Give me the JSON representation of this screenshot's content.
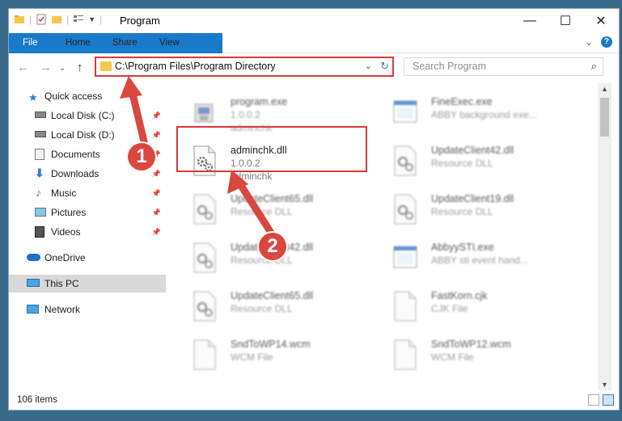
{
  "titlebar": {
    "title": "Program",
    "minimize": "—",
    "maximize": "☐",
    "close": "✕"
  },
  "ribbon": {
    "tabs": [
      "File",
      "Home",
      "Share",
      "View"
    ],
    "expand": "⌄",
    "help": "?"
  },
  "address": {
    "path": "C:\\Program Files\\Program Directory",
    "dropdown": "⌄",
    "refresh": "↻"
  },
  "search": {
    "placeholder": "Search Program",
    "icon": "⌕"
  },
  "nav": {
    "back": "←",
    "forward": "→",
    "history": "⌄",
    "up": "↑"
  },
  "sidebar": {
    "items": [
      {
        "label": "Quick access",
        "icon": "star-icon",
        "pinned": false
      },
      {
        "label": "Local Disk (C:)",
        "icon": "drive-icon",
        "pinned": true
      },
      {
        "label": "Local Disk (D:)",
        "icon": "drive-icon",
        "pinned": true
      },
      {
        "label": "Documents",
        "icon": "documents-icon",
        "pinned": true
      },
      {
        "label": "Downloads",
        "icon": "downloads-icon",
        "pinned": true
      },
      {
        "label": "Music",
        "icon": "music-icon",
        "pinned": true
      },
      {
        "label": "Pictures",
        "icon": "pictures-icon",
        "pinned": true
      },
      {
        "label": "Videos",
        "icon": "videos-icon",
        "pinned": true
      },
      {
        "label": "OneDrive",
        "icon": "cloud-icon",
        "pinned": false
      },
      {
        "label": "This PC",
        "icon": "computer-icon",
        "pinned": false
      },
      {
        "label": "Network",
        "icon": "network-icon",
        "pinned": false
      }
    ],
    "pin_glyph": "📌"
  },
  "files": [
    {
      "name": "program.exe",
      "line2": "1.0.0.2",
      "line3": "adminchk",
      "icon": "exe-icon",
      "blurred": true
    },
    {
      "name": "FineExec.exe",
      "line2": "ABBY background exe...",
      "line3": "",
      "icon": "app-window-icon",
      "blurred": true
    },
    {
      "name": "adminchk.dll",
      "line2": "1.0.0.2",
      "line3": "adminchk",
      "icon": "dll-gear-icon",
      "blurred": false
    },
    {
      "name": "UpdateClient42.dll",
      "line2": "Resource DLL",
      "line3": "",
      "icon": "dll-gear-icon",
      "blurred": true
    },
    {
      "name": "UpdateClient65.dll",
      "line2": "Resource DLL",
      "line3": "",
      "icon": "dll-gear-icon",
      "blurred": true
    },
    {
      "name": "UpdateClient19.dll",
      "line2": "Resource DLL",
      "line3": "",
      "icon": "dll-gear-icon",
      "blurred": true
    },
    {
      "name": "UpdateClient42.dll",
      "line2": "Resource DLL",
      "line3": "",
      "icon": "dll-gear-icon",
      "blurred": true
    },
    {
      "name": "AbbyySTI.exe",
      "line2": "ABBY sti event hand...",
      "line3": "",
      "icon": "app-window-icon",
      "blurred": true
    },
    {
      "name": "UpdateClient65.dll",
      "line2": "Resource DLL",
      "line3": "",
      "icon": "dll-gear-icon",
      "blurred": true
    },
    {
      "name": "FastKorn.cjk",
      "line2": "CJK File",
      "line3": "",
      "icon": "blank-file-icon",
      "blurred": true
    },
    {
      "name": "SndToWP14.wcm",
      "line2": "WCM File",
      "line3": "",
      "icon": "blank-file-icon",
      "blurred": true
    },
    {
      "name": "SndToWP12.wcm",
      "line2": "WCM File",
      "line3": "",
      "icon": "blank-file-icon",
      "blurred": true
    }
  ],
  "status": {
    "item_count": "106 items"
  },
  "annotations": {
    "step1": "1",
    "step2": "2",
    "color": "#d9473f"
  }
}
